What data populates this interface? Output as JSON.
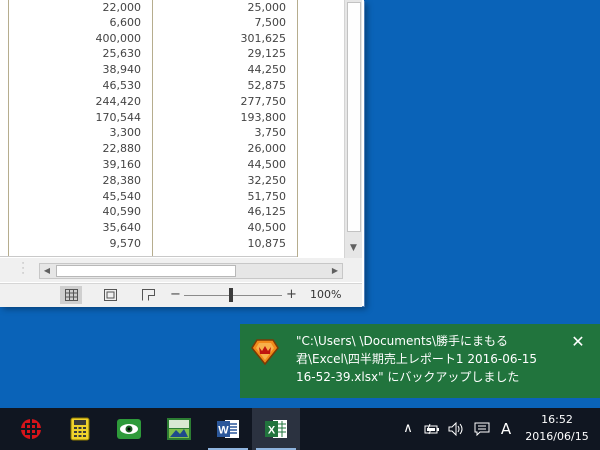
{
  "excel": {
    "rows": [
      {
        "a": "22,000",
        "b": "25,000"
      },
      {
        "a": "6,600",
        "b": "7,500"
      },
      {
        "a": "400,000",
        "b": "301,625"
      },
      {
        "a": "25,630",
        "b": "29,125"
      },
      {
        "a": "38,940",
        "b": "44,250"
      },
      {
        "a": "46,530",
        "b": "52,875"
      },
      {
        "a": "244,420",
        "b": "277,750"
      },
      {
        "a": "170,544",
        "b": "193,800"
      },
      {
        "a": "3,300",
        "b": "3,750"
      },
      {
        "a": "22,880",
        "b": "26,000"
      },
      {
        "a": "39,160",
        "b": "44,500"
      },
      {
        "a": "28,380",
        "b": "32,250"
      },
      {
        "a": "45,540",
        "b": "51,750"
      },
      {
        "a": "40,590",
        "b": "46,125"
      },
      {
        "a": "35,640",
        "b": "40,500"
      },
      {
        "a": "9,570",
        "b": "10,875"
      }
    ],
    "statusbar": {
      "zoom_minus": "−",
      "zoom_plus": "+",
      "zoom_level": "100%",
      "active_view": "normal"
    }
  },
  "toast": {
    "line1": "\"C:\\Users\\            \\Documents\\勝手にまもる",
    "line2": "君\\Excel\\四半期売上レポート1 2016-06-15",
    "line3": "16-52-39.xlsx\" にバックアップしました",
    "close": "✕",
    "icon": "app-shield-icon",
    "color": "#21743d"
  },
  "taskbar": {
    "apps": [
      {
        "name": "red-security-app-icon"
      },
      {
        "name": "calculator-app-icon"
      },
      {
        "name": "eye-viewer-app-icon"
      },
      {
        "name": "image-app-icon"
      },
      {
        "name": "word-icon"
      },
      {
        "name": "excel-icon"
      }
    ],
    "tray": {
      "chevron": "∧",
      "ime": "A"
    },
    "clock": {
      "time": "16:52",
      "date": "2016/06/15"
    }
  },
  "colors": {
    "desktop": "#0a63b8",
    "taskbar": "#101621",
    "excel_green": "#21743d"
  }
}
